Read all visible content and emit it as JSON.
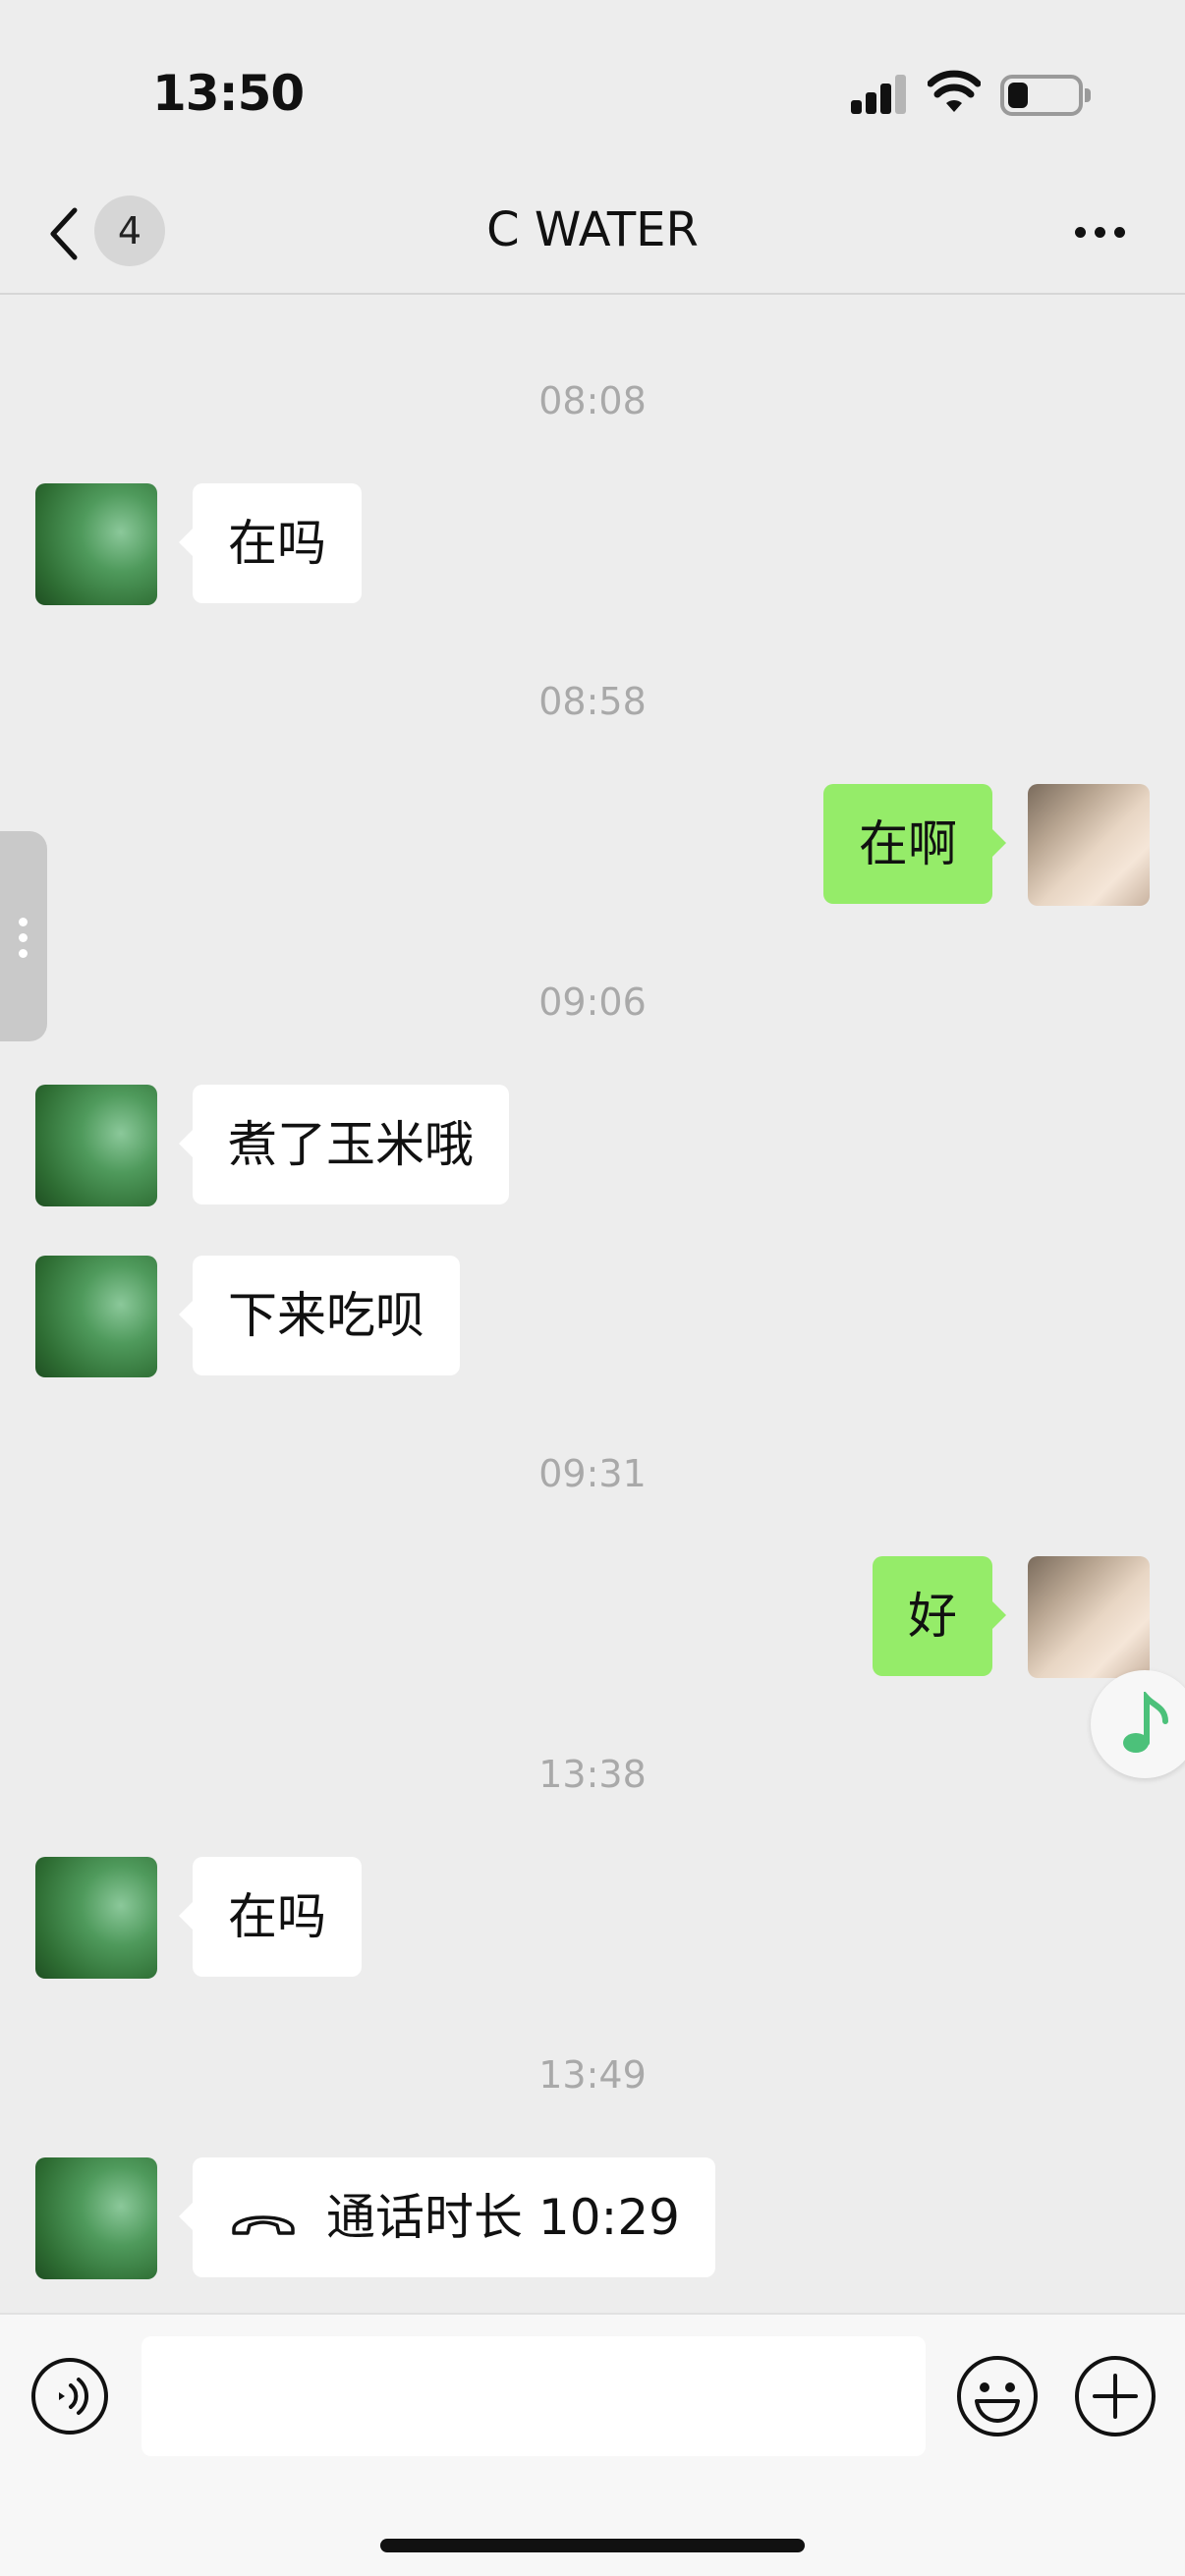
{
  "status_bar": {
    "time": "13:50",
    "battery_level": 0.3
  },
  "nav": {
    "unread_count": "4",
    "title": "C WATER"
  },
  "messages": [
    {
      "time": "08:08"
    },
    {
      "from": "contact",
      "text": "在吗"
    },
    {
      "time": "08:58"
    },
    {
      "from": "me",
      "text": "在啊"
    },
    {
      "time": "09:06"
    },
    {
      "from": "contact",
      "text": "煮了玉米哦"
    },
    {
      "from": "contact",
      "text": "下来吃呗"
    },
    {
      "time": "09:31"
    },
    {
      "from": "me",
      "text": "好"
    },
    {
      "time": "13:38"
    },
    {
      "from": "contact",
      "text": "在吗"
    },
    {
      "time": "13:49"
    },
    {
      "from": "contact",
      "type": "call",
      "icon": "phone-icon",
      "text": "通话时长 10:29"
    }
  ],
  "input": {
    "value": "",
    "placeholder": ""
  },
  "colors": {
    "background": "#ededed",
    "incoming_bubble": "#ffffff",
    "outgoing_bubble": "#95ec69",
    "timestamp": "#a9a9a9",
    "music_accent": "#4cc17a"
  },
  "icons": [
    "back-chevron-icon",
    "more-icon",
    "voice-icon",
    "emoji-icon",
    "plus-icon",
    "music-note-icon",
    "phone-icon"
  ]
}
